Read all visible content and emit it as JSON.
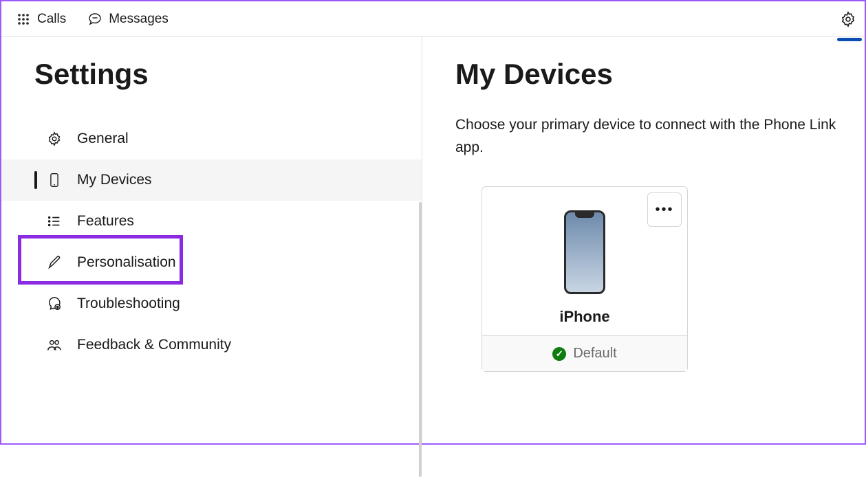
{
  "topbar": {
    "calls_label": "Calls",
    "messages_label": "Messages"
  },
  "sidebar": {
    "title": "Settings",
    "items": [
      {
        "label": "General",
        "icon": "gear-icon"
      },
      {
        "label": "My Devices",
        "icon": "phone-icon",
        "active": true
      },
      {
        "label": "Features",
        "icon": "list-icon"
      },
      {
        "label": "Personalisation",
        "icon": "pen-icon"
      },
      {
        "label": "Troubleshooting",
        "icon": "help-icon"
      },
      {
        "label": "Feedback & Community",
        "icon": "people-icon"
      }
    ]
  },
  "main": {
    "title": "My Devices",
    "description": "Choose your primary device to connect with the Phone Link app.",
    "device": {
      "name": "iPhone",
      "status_label": "Default",
      "status_ok": true
    }
  }
}
